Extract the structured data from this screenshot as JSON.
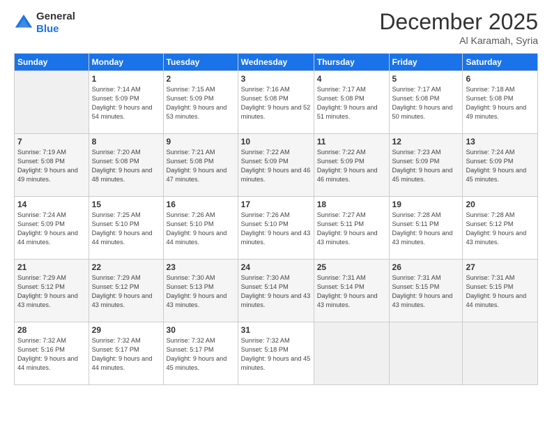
{
  "logo": {
    "line1": "General",
    "line2": "Blue"
  },
  "title": "December 2025",
  "subtitle": "Al Karamah, Syria",
  "weekdays": [
    "Sunday",
    "Monday",
    "Tuesday",
    "Wednesday",
    "Thursday",
    "Friday",
    "Saturday"
  ],
  "weeks": [
    [
      {
        "day": "",
        "sunrise": "",
        "sunset": "",
        "daylight": ""
      },
      {
        "day": "1",
        "sunrise": "Sunrise: 7:14 AM",
        "sunset": "Sunset: 5:09 PM",
        "daylight": "Daylight: 9 hours and 54 minutes."
      },
      {
        "day": "2",
        "sunrise": "Sunrise: 7:15 AM",
        "sunset": "Sunset: 5:09 PM",
        "daylight": "Daylight: 9 hours and 53 minutes."
      },
      {
        "day": "3",
        "sunrise": "Sunrise: 7:16 AM",
        "sunset": "Sunset: 5:08 PM",
        "daylight": "Daylight: 9 hours and 52 minutes."
      },
      {
        "day": "4",
        "sunrise": "Sunrise: 7:17 AM",
        "sunset": "Sunset: 5:08 PM",
        "daylight": "Daylight: 9 hours and 51 minutes."
      },
      {
        "day": "5",
        "sunrise": "Sunrise: 7:17 AM",
        "sunset": "Sunset: 5:08 PM",
        "daylight": "Daylight: 9 hours and 50 minutes."
      },
      {
        "day": "6",
        "sunrise": "Sunrise: 7:18 AM",
        "sunset": "Sunset: 5:08 PM",
        "daylight": "Daylight: 9 hours and 49 minutes."
      }
    ],
    [
      {
        "day": "7",
        "sunrise": "Sunrise: 7:19 AM",
        "sunset": "Sunset: 5:08 PM",
        "daylight": "Daylight: 9 hours and 49 minutes."
      },
      {
        "day": "8",
        "sunrise": "Sunrise: 7:20 AM",
        "sunset": "Sunset: 5:08 PM",
        "daylight": "Daylight: 9 hours and 48 minutes."
      },
      {
        "day": "9",
        "sunrise": "Sunrise: 7:21 AM",
        "sunset": "Sunset: 5:08 PM",
        "daylight": "Daylight: 9 hours and 47 minutes."
      },
      {
        "day": "10",
        "sunrise": "Sunrise: 7:22 AM",
        "sunset": "Sunset: 5:09 PM",
        "daylight": "Daylight: 9 hours and 46 minutes."
      },
      {
        "day": "11",
        "sunrise": "Sunrise: 7:22 AM",
        "sunset": "Sunset: 5:09 PM",
        "daylight": "Daylight: 9 hours and 46 minutes."
      },
      {
        "day": "12",
        "sunrise": "Sunrise: 7:23 AM",
        "sunset": "Sunset: 5:09 PM",
        "daylight": "Daylight: 9 hours and 45 minutes."
      },
      {
        "day": "13",
        "sunrise": "Sunrise: 7:24 AM",
        "sunset": "Sunset: 5:09 PM",
        "daylight": "Daylight: 9 hours and 45 minutes."
      }
    ],
    [
      {
        "day": "14",
        "sunrise": "Sunrise: 7:24 AM",
        "sunset": "Sunset: 5:09 PM",
        "daylight": "Daylight: 9 hours and 44 minutes."
      },
      {
        "day": "15",
        "sunrise": "Sunrise: 7:25 AM",
        "sunset": "Sunset: 5:10 PM",
        "daylight": "Daylight: 9 hours and 44 minutes."
      },
      {
        "day": "16",
        "sunrise": "Sunrise: 7:26 AM",
        "sunset": "Sunset: 5:10 PM",
        "daylight": "Daylight: 9 hours and 44 minutes."
      },
      {
        "day": "17",
        "sunrise": "Sunrise: 7:26 AM",
        "sunset": "Sunset: 5:10 PM",
        "daylight": "Daylight: 9 hours and 43 minutes."
      },
      {
        "day": "18",
        "sunrise": "Sunrise: 7:27 AM",
        "sunset": "Sunset: 5:11 PM",
        "daylight": "Daylight: 9 hours and 43 minutes."
      },
      {
        "day": "19",
        "sunrise": "Sunrise: 7:28 AM",
        "sunset": "Sunset: 5:11 PM",
        "daylight": "Daylight: 9 hours and 43 minutes."
      },
      {
        "day": "20",
        "sunrise": "Sunrise: 7:28 AM",
        "sunset": "Sunset: 5:12 PM",
        "daylight": "Daylight: 9 hours and 43 minutes."
      }
    ],
    [
      {
        "day": "21",
        "sunrise": "Sunrise: 7:29 AM",
        "sunset": "Sunset: 5:12 PM",
        "daylight": "Daylight: 9 hours and 43 minutes."
      },
      {
        "day": "22",
        "sunrise": "Sunrise: 7:29 AM",
        "sunset": "Sunset: 5:12 PM",
        "daylight": "Daylight: 9 hours and 43 minutes."
      },
      {
        "day": "23",
        "sunrise": "Sunrise: 7:30 AM",
        "sunset": "Sunset: 5:13 PM",
        "daylight": "Daylight: 9 hours and 43 minutes."
      },
      {
        "day": "24",
        "sunrise": "Sunrise: 7:30 AM",
        "sunset": "Sunset: 5:14 PM",
        "daylight": "Daylight: 9 hours and 43 minutes."
      },
      {
        "day": "25",
        "sunrise": "Sunrise: 7:31 AM",
        "sunset": "Sunset: 5:14 PM",
        "daylight": "Daylight: 9 hours and 43 minutes."
      },
      {
        "day": "26",
        "sunrise": "Sunrise: 7:31 AM",
        "sunset": "Sunset: 5:15 PM",
        "daylight": "Daylight: 9 hours and 43 minutes."
      },
      {
        "day": "27",
        "sunrise": "Sunrise: 7:31 AM",
        "sunset": "Sunset: 5:15 PM",
        "daylight": "Daylight: 9 hours and 44 minutes."
      }
    ],
    [
      {
        "day": "28",
        "sunrise": "Sunrise: 7:32 AM",
        "sunset": "Sunset: 5:16 PM",
        "daylight": "Daylight: 9 hours and 44 minutes."
      },
      {
        "day": "29",
        "sunrise": "Sunrise: 7:32 AM",
        "sunset": "Sunset: 5:17 PM",
        "daylight": "Daylight: 9 hours and 44 minutes."
      },
      {
        "day": "30",
        "sunrise": "Sunrise: 7:32 AM",
        "sunset": "Sunset: 5:17 PM",
        "daylight": "Daylight: 9 hours and 45 minutes."
      },
      {
        "day": "31",
        "sunrise": "Sunrise: 7:32 AM",
        "sunset": "Sunset: 5:18 PM",
        "daylight": "Daylight: 9 hours and 45 minutes."
      },
      {
        "day": "",
        "sunrise": "",
        "sunset": "",
        "daylight": ""
      },
      {
        "day": "",
        "sunrise": "",
        "sunset": "",
        "daylight": ""
      },
      {
        "day": "",
        "sunrise": "",
        "sunset": "",
        "daylight": ""
      }
    ]
  ]
}
